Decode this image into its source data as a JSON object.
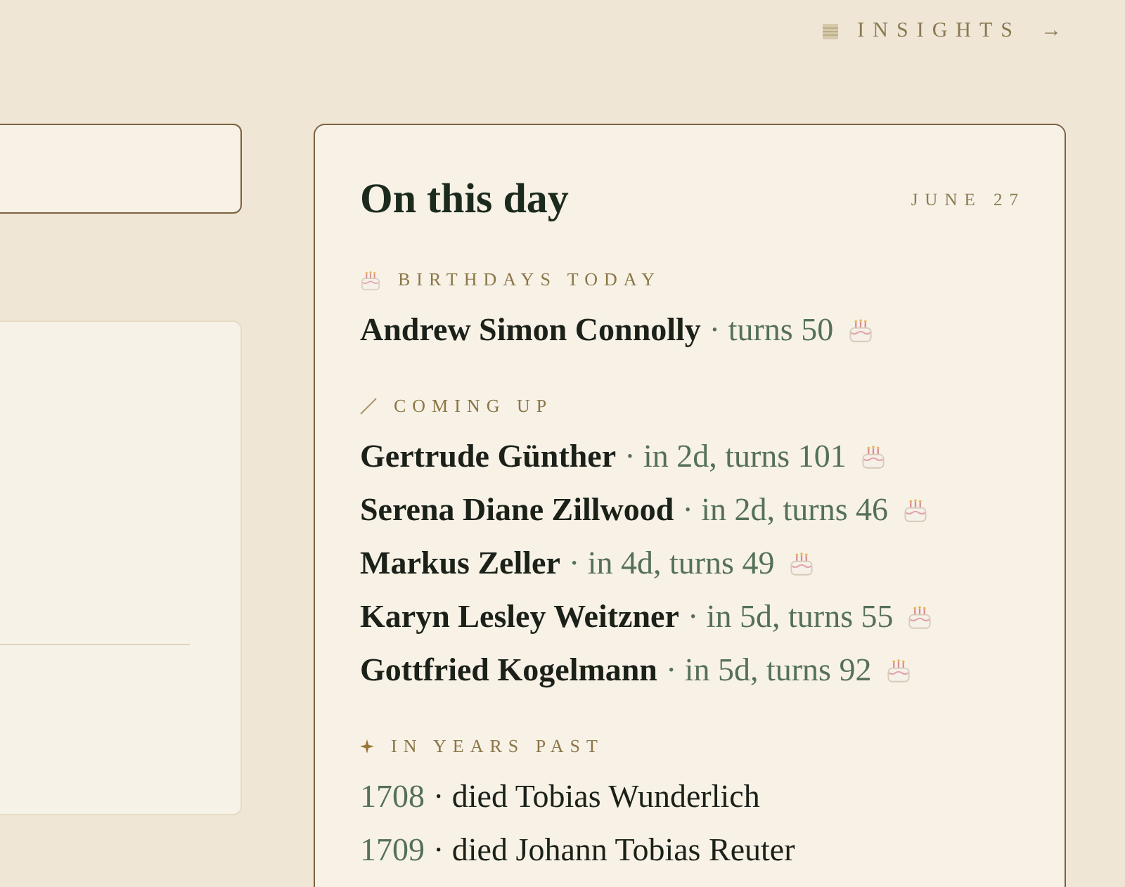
{
  "top_bar": {
    "insights_link": {
      "label": "INSIGHTS",
      "arrow": "→"
    }
  },
  "on_this_day": {
    "title": "On this day",
    "date": "JUNE 27",
    "sections": [
      {
        "kind": "today",
        "heading": "BIRTHDAYS TODAY",
        "items": [
          {
            "name": "Andrew Simon Connolly",
            "detail": "· turns 50"
          }
        ]
      },
      {
        "kind": "upcoming",
        "heading": "COMING UP",
        "items": [
          {
            "name": "Gertrude Günther",
            "detail": "· in 2d, turns 101"
          },
          {
            "name": "Serena Diane Zillwood",
            "detail": "· in 2d, turns 46"
          },
          {
            "name": "Markus Zeller",
            "detail": "· in 4d, turns 49"
          },
          {
            "name": "Karyn Lesley Weitzner",
            "detail": "· in 5d, turns 55"
          },
          {
            "name": "Gottfried Kogelmann",
            "detail": "· in 5d, turns 92"
          }
        ]
      },
      {
        "kind": "history",
        "heading": "IN YEARS PAST",
        "items": [
          {
            "year": "1708",
            "text": "· died Tobias Wunderlich"
          },
          {
            "year": "1709",
            "text": "· died Johann Tobias Reuter"
          }
        ]
      }
    ]
  }
}
